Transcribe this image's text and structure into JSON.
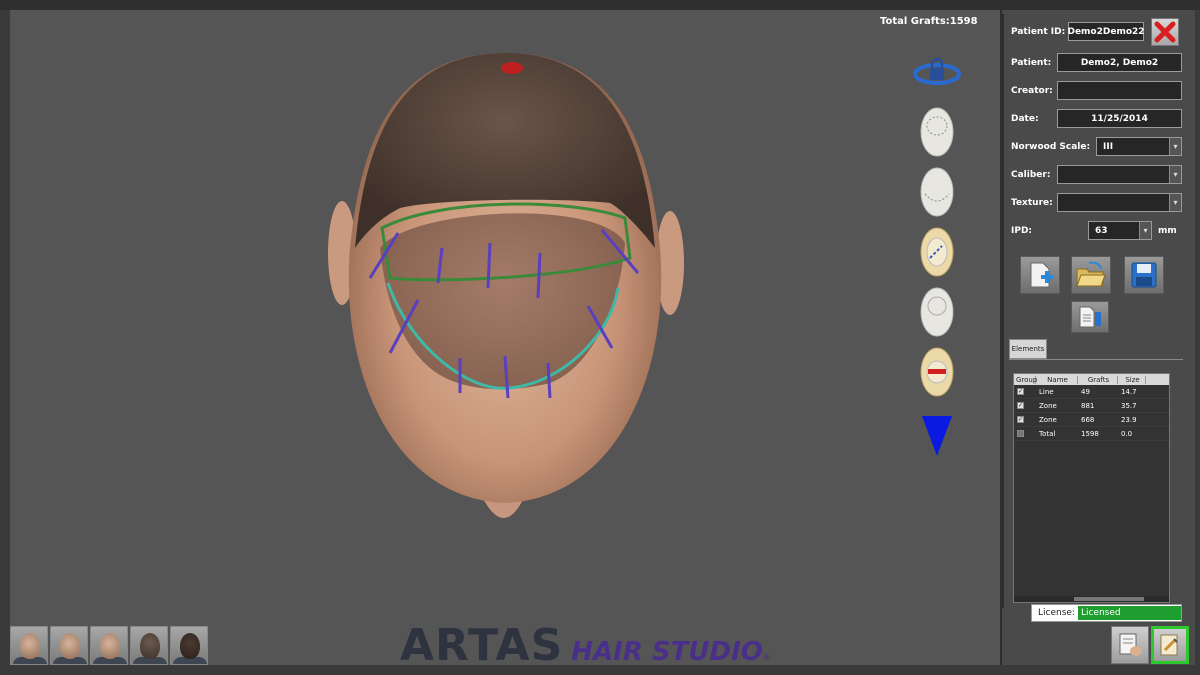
{
  "viewer": {
    "total_grafts_label": "Total Grafts:1598"
  },
  "tools": [
    {
      "icon": "lock-rotate-icon"
    },
    {
      "icon": "head-zone-outline-icon"
    },
    {
      "icon": "head-zone-bottom-icon"
    },
    {
      "icon": "head-line-edit-icon"
    },
    {
      "icon": "head-blank-icon"
    },
    {
      "icon": "head-remove-icon"
    },
    {
      "icon": "scroll-down-triangle-icon"
    }
  ],
  "form": {
    "patient_id_label": "Patient ID:",
    "patient_id_value": "Demo2Demo22",
    "patient_label": "Patient:",
    "patient_value": "Demo2, Demo2",
    "creator_label": "Creator:",
    "creator_value": "",
    "date_label": "Date:",
    "date_value": "11/25/2014",
    "norwood_label": "Norwood Scale:",
    "norwood_value": "III",
    "caliber_label": "Caliber:",
    "caliber_value": "",
    "texture_label": "Texture:",
    "texture_value": "",
    "ipd_label": "IPD:",
    "ipd_value": "63",
    "ipd_unit": "mm"
  },
  "actions": [
    {
      "icon": "new-document-icon"
    },
    {
      "icon": "open-folder-icon"
    },
    {
      "icon": "save-disk-icon"
    },
    {
      "icon": "export-usb-icon"
    }
  ],
  "elements": {
    "tab_label": "Elements",
    "columns": [
      "Group",
      "Name",
      "Grafts",
      "Size"
    ],
    "rows": [
      {
        "checked": true,
        "name": "Line",
        "grafts": "49",
        "size": "14.7"
      },
      {
        "checked": true,
        "name": "Zone",
        "grafts": "881",
        "size": "35.7"
      },
      {
        "checked": true,
        "name": "Zone",
        "grafts": "668",
        "size": "23.9"
      },
      {
        "checked": false,
        "name": "Total",
        "grafts": "1598",
        "size": "0.0"
      }
    ]
  },
  "license": {
    "label": "License:",
    "value": "Licensed",
    "value_color": "#1e9e2e"
  },
  "logo": {
    "brand": "ARTAS",
    "product": "HAIR STUDIO",
    "registered": "®"
  },
  "colors": {
    "viewport": "#555555",
    "hairline_zone": "#3a8a3a",
    "hairline_edge": "#3fb8a8",
    "direction_marks": "#5a3fc0",
    "triangle": "#0a1ae0",
    "close_icon": "#d82020"
  }
}
